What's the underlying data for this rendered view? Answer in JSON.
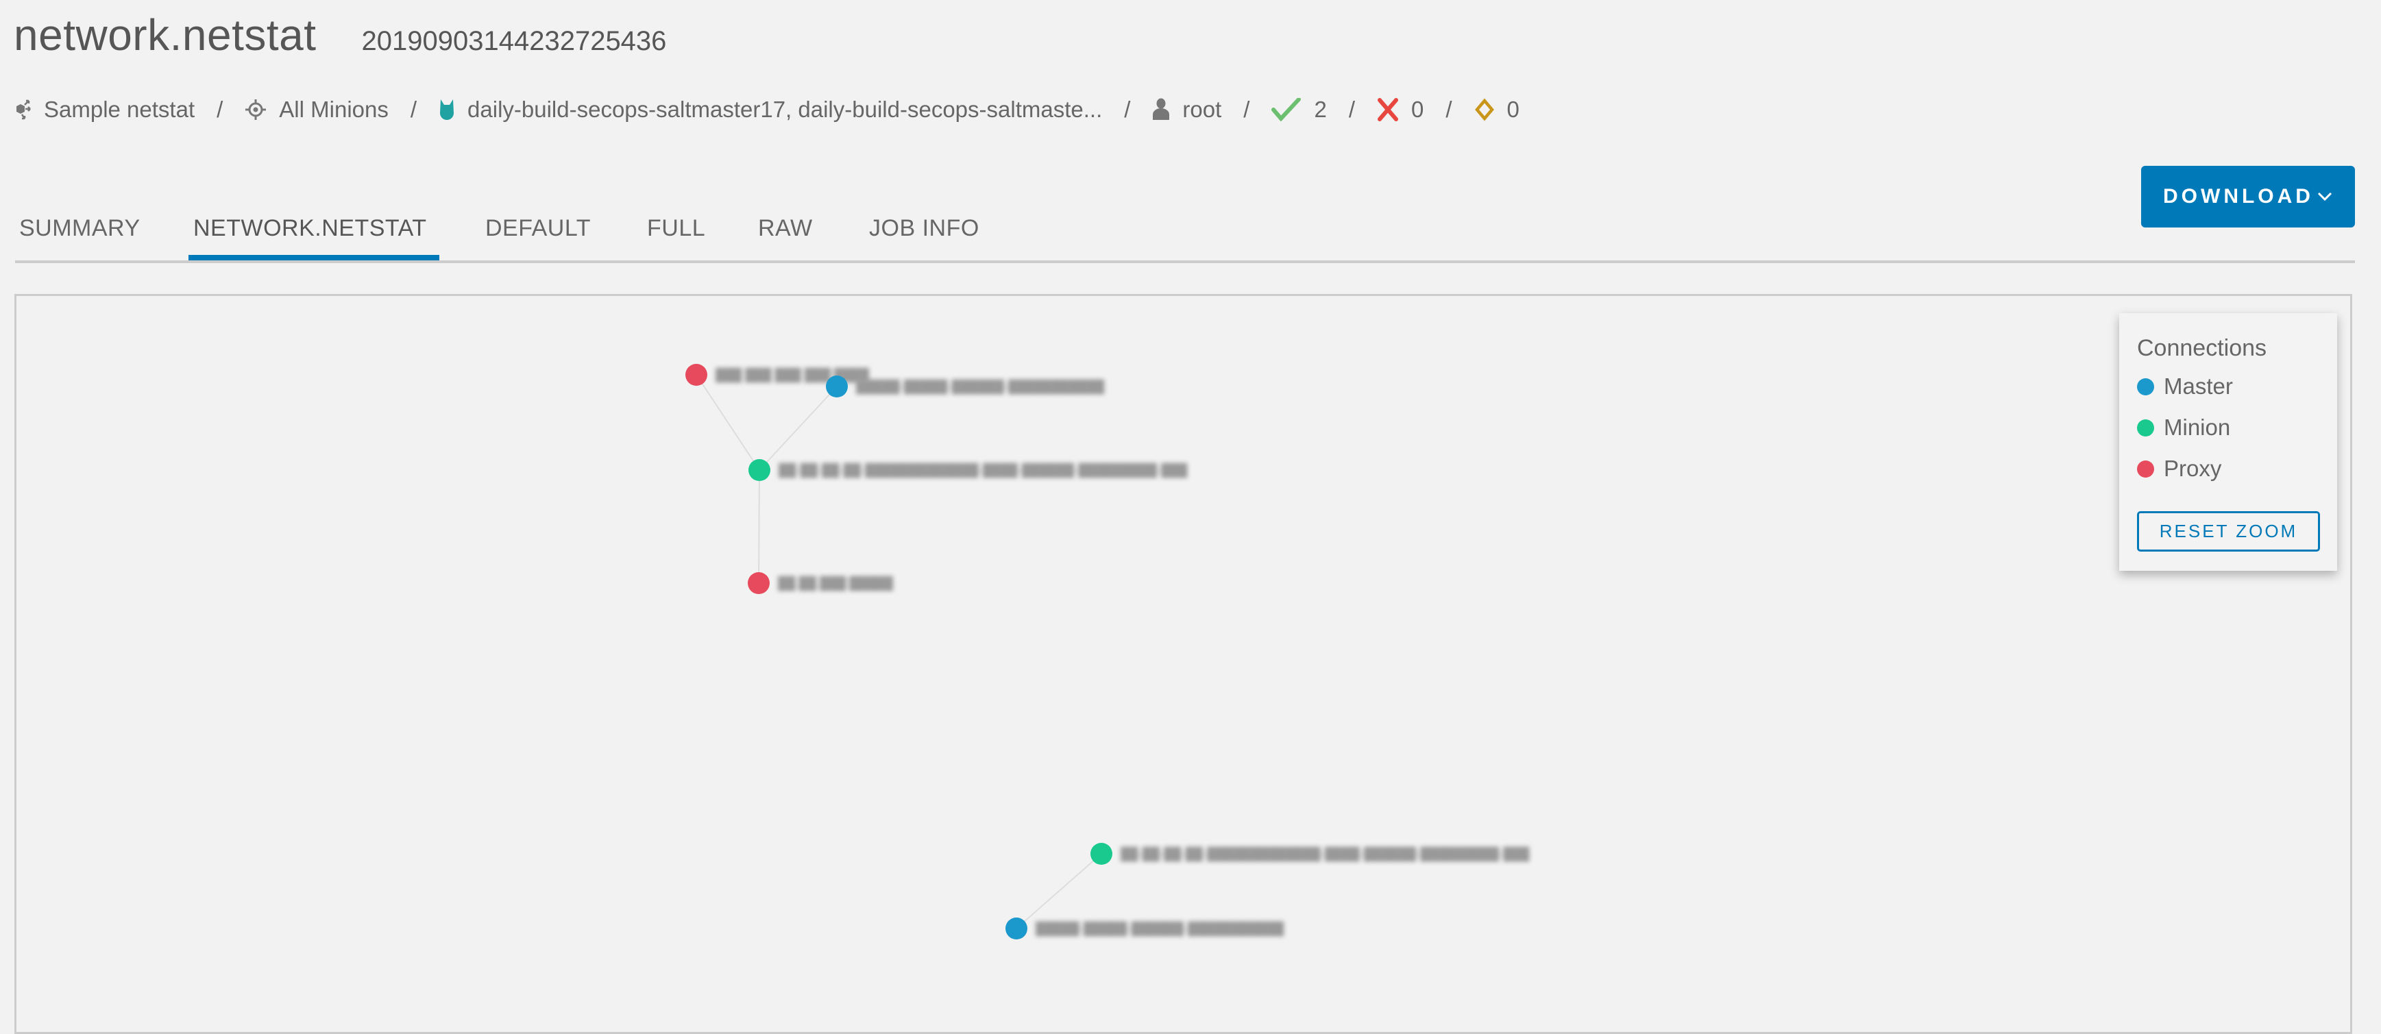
{
  "header": {
    "title": "network.netstat",
    "job_id": "20190903144232725436"
  },
  "meta": {
    "job_name": "Sample netstat",
    "target": "All Minions",
    "minions": "daily-build-secops-saltmaster17, daily-build-secops-saltmaste...",
    "user": "root",
    "success_count": "2",
    "failure_count": "0",
    "pending_count": "0",
    "separator": "/",
    "colors": {
      "success": "#6cbf6f",
      "failure": "#e8473f",
      "pending": "#c9961a",
      "minion_icon": "#21a2a2"
    }
  },
  "tabs": [
    {
      "label": "SUMMARY",
      "active": false
    },
    {
      "label": "NETWORK.NETSTAT",
      "active": true
    },
    {
      "label": "DEFAULT",
      "active": false
    },
    {
      "label": "FULL",
      "active": false
    },
    {
      "label": "RAW",
      "active": false
    },
    {
      "label": "JOB INFO",
      "active": false
    }
  ],
  "toolbar": {
    "download_label": "DOWNLOAD"
  },
  "legend": {
    "title": "Connections",
    "items": [
      {
        "label": "Master",
        "color": "#1b99cc"
      },
      {
        "label": "Minion",
        "color": "#19c98e"
      },
      {
        "label": "Proxy",
        "color": "#e64a5c"
      }
    ],
    "reset_label": "RESET ZOOM"
  },
  "graph": {
    "note": "node labels are blurred/obscured in the screenshot",
    "nodes": [
      {
        "id": "p1",
        "type": "Proxy",
        "label": "███ ███ ███ ███:████"
      },
      {
        "id": "m1",
        "type": "Master",
        "label": "█████-█████-██████-███████████"
      },
      {
        "id": "n1",
        "type": "Minion",
        "label": "██-██-██-██-█████████████-████-██████-█████████-███"
      },
      {
        "id": "p2",
        "type": "Proxy",
        "label": "██.██.███:█████"
      },
      {
        "id": "n2",
        "type": "Minion",
        "label": "██-██-██-██-█████████████-████-██████-█████████-███"
      },
      {
        "id": "m2",
        "type": "Master",
        "label": "█████-█████-██████-███████████"
      }
    ],
    "edges": [
      {
        "from": "p1",
        "to": "n1"
      },
      {
        "from": "m1",
        "to": "n1"
      },
      {
        "from": "n1",
        "to": "p2"
      },
      {
        "from": "n2",
        "to": "m2"
      }
    ],
    "colors": {
      "Master": "#1b99cc",
      "Minion": "#19c98e",
      "Proxy": "#e64a5c",
      "edge": "#dddddd"
    }
  }
}
